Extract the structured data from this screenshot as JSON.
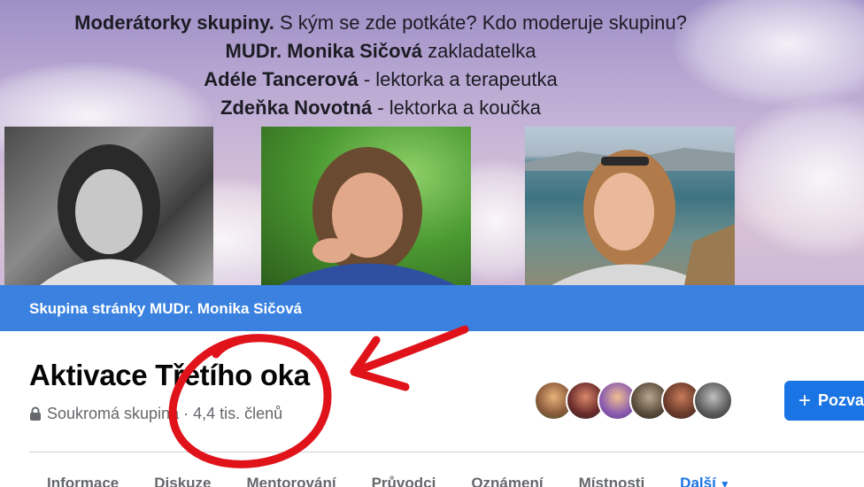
{
  "cover": {
    "line1_bold": "Moderátorky skupiny.",
    "line1_rest": " S kým se zde potkáte? Kdo moderuje skupinu?",
    "line2_bold": "MUDr. Monika Sičová",
    "line2_rest": " zakladatelka",
    "line3_bold": "Adéle Tancerová",
    "line3_rest": " - lektorka a terapeutka",
    "line4_bold": "Zdeňka Novotná",
    "line4_rest": " - lektorka a koučka"
  },
  "page_bar": {
    "label": "Skupina stránky MUDr. Monika Sičová"
  },
  "group": {
    "title": "Aktivace Třetího oka",
    "privacy": "Soukromá skupina",
    "separator": " · ",
    "members": "4,4 tis. členů"
  },
  "invite_button": {
    "label": "Pozvat"
  },
  "tabs": [
    {
      "label": "Informace"
    },
    {
      "label": "Diskuze"
    },
    {
      "label": "Mentorování"
    },
    {
      "label": "Průvodci"
    },
    {
      "label": "Oznámení"
    },
    {
      "label": "Místnosti"
    },
    {
      "label": "Další"
    }
  ],
  "colors": {
    "page_bar": "#3b82e0",
    "primary_button": "#1b74e4",
    "annotation_red": "#e0131b",
    "secondary_text": "#65676b"
  },
  "icons": {
    "privacy": "lock-icon",
    "invite": "plus-icon",
    "more_tabs": "caret-down-icon"
  }
}
